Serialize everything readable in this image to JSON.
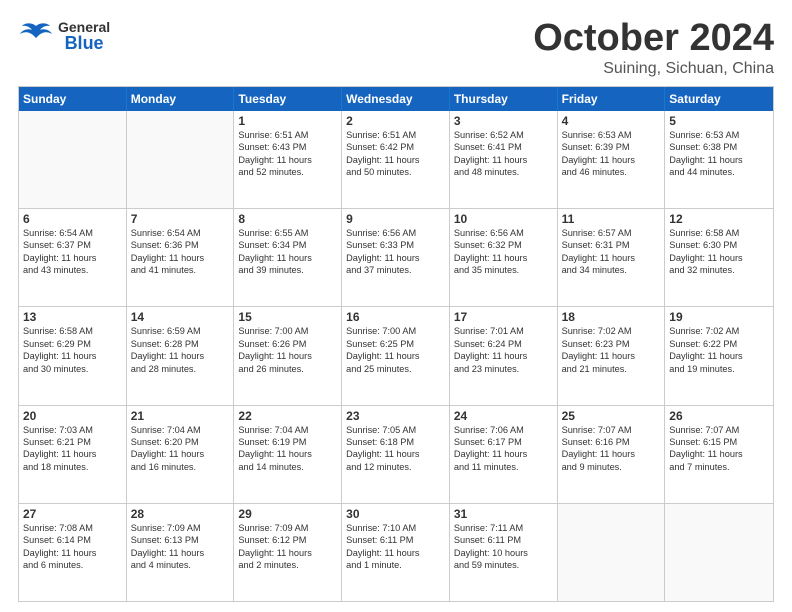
{
  "header": {
    "logo": {
      "general": "General",
      "blue": "Blue"
    },
    "title": "October 2024",
    "subtitle": "Suining, Sichuan, China"
  },
  "calendar": {
    "days": [
      "Sunday",
      "Monday",
      "Tuesday",
      "Wednesday",
      "Thursday",
      "Friday",
      "Saturday"
    ],
    "rows": [
      [
        {
          "day": "",
          "lines": []
        },
        {
          "day": "",
          "lines": []
        },
        {
          "day": "1",
          "lines": [
            "Sunrise: 6:51 AM",
            "Sunset: 6:43 PM",
            "Daylight: 11 hours",
            "and 52 minutes."
          ]
        },
        {
          "day": "2",
          "lines": [
            "Sunrise: 6:51 AM",
            "Sunset: 6:42 PM",
            "Daylight: 11 hours",
            "and 50 minutes."
          ]
        },
        {
          "day": "3",
          "lines": [
            "Sunrise: 6:52 AM",
            "Sunset: 6:41 PM",
            "Daylight: 11 hours",
            "and 48 minutes."
          ]
        },
        {
          "day": "4",
          "lines": [
            "Sunrise: 6:53 AM",
            "Sunset: 6:39 PM",
            "Daylight: 11 hours",
            "and 46 minutes."
          ]
        },
        {
          "day": "5",
          "lines": [
            "Sunrise: 6:53 AM",
            "Sunset: 6:38 PM",
            "Daylight: 11 hours",
            "and 44 minutes."
          ]
        }
      ],
      [
        {
          "day": "6",
          "lines": [
            "Sunrise: 6:54 AM",
            "Sunset: 6:37 PM",
            "Daylight: 11 hours",
            "and 43 minutes."
          ]
        },
        {
          "day": "7",
          "lines": [
            "Sunrise: 6:54 AM",
            "Sunset: 6:36 PM",
            "Daylight: 11 hours",
            "and 41 minutes."
          ]
        },
        {
          "day": "8",
          "lines": [
            "Sunrise: 6:55 AM",
            "Sunset: 6:34 PM",
            "Daylight: 11 hours",
            "and 39 minutes."
          ]
        },
        {
          "day": "9",
          "lines": [
            "Sunrise: 6:56 AM",
            "Sunset: 6:33 PM",
            "Daylight: 11 hours",
            "and 37 minutes."
          ]
        },
        {
          "day": "10",
          "lines": [
            "Sunrise: 6:56 AM",
            "Sunset: 6:32 PM",
            "Daylight: 11 hours",
            "and 35 minutes."
          ]
        },
        {
          "day": "11",
          "lines": [
            "Sunrise: 6:57 AM",
            "Sunset: 6:31 PM",
            "Daylight: 11 hours",
            "and 34 minutes."
          ]
        },
        {
          "day": "12",
          "lines": [
            "Sunrise: 6:58 AM",
            "Sunset: 6:30 PM",
            "Daylight: 11 hours",
            "and 32 minutes."
          ]
        }
      ],
      [
        {
          "day": "13",
          "lines": [
            "Sunrise: 6:58 AM",
            "Sunset: 6:29 PM",
            "Daylight: 11 hours",
            "and 30 minutes."
          ]
        },
        {
          "day": "14",
          "lines": [
            "Sunrise: 6:59 AM",
            "Sunset: 6:28 PM",
            "Daylight: 11 hours",
            "and 28 minutes."
          ]
        },
        {
          "day": "15",
          "lines": [
            "Sunrise: 7:00 AM",
            "Sunset: 6:26 PM",
            "Daylight: 11 hours",
            "and 26 minutes."
          ]
        },
        {
          "day": "16",
          "lines": [
            "Sunrise: 7:00 AM",
            "Sunset: 6:25 PM",
            "Daylight: 11 hours",
            "and 25 minutes."
          ]
        },
        {
          "day": "17",
          "lines": [
            "Sunrise: 7:01 AM",
            "Sunset: 6:24 PM",
            "Daylight: 11 hours",
            "and 23 minutes."
          ]
        },
        {
          "day": "18",
          "lines": [
            "Sunrise: 7:02 AM",
            "Sunset: 6:23 PM",
            "Daylight: 11 hours",
            "and 21 minutes."
          ]
        },
        {
          "day": "19",
          "lines": [
            "Sunrise: 7:02 AM",
            "Sunset: 6:22 PM",
            "Daylight: 11 hours",
            "and 19 minutes."
          ]
        }
      ],
      [
        {
          "day": "20",
          "lines": [
            "Sunrise: 7:03 AM",
            "Sunset: 6:21 PM",
            "Daylight: 11 hours",
            "and 18 minutes."
          ]
        },
        {
          "day": "21",
          "lines": [
            "Sunrise: 7:04 AM",
            "Sunset: 6:20 PM",
            "Daylight: 11 hours",
            "and 16 minutes."
          ]
        },
        {
          "day": "22",
          "lines": [
            "Sunrise: 7:04 AM",
            "Sunset: 6:19 PM",
            "Daylight: 11 hours",
            "and 14 minutes."
          ]
        },
        {
          "day": "23",
          "lines": [
            "Sunrise: 7:05 AM",
            "Sunset: 6:18 PM",
            "Daylight: 11 hours",
            "and 12 minutes."
          ]
        },
        {
          "day": "24",
          "lines": [
            "Sunrise: 7:06 AM",
            "Sunset: 6:17 PM",
            "Daylight: 11 hours",
            "and 11 minutes."
          ]
        },
        {
          "day": "25",
          "lines": [
            "Sunrise: 7:07 AM",
            "Sunset: 6:16 PM",
            "Daylight: 11 hours",
            "and 9 minutes."
          ]
        },
        {
          "day": "26",
          "lines": [
            "Sunrise: 7:07 AM",
            "Sunset: 6:15 PM",
            "Daylight: 11 hours",
            "and 7 minutes."
          ]
        }
      ],
      [
        {
          "day": "27",
          "lines": [
            "Sunrise: 7:08 AM",
            "Sunset: 6:14 PM",
            "Daylight: 11 hours",
            "and 6 minutes."
          ]
        },
        {
          "day": "28",
          "lines": [
            "Sunrise: 7:09 AM",
            "Sunset: 6:13 PM",
            "Daylight: 11 hours",
            "and 4 minutes."
          ]
        },
        {
          "day": "29",
          "lines": [
            "Sunrise: 7:09 AM",
            "Sunset: 6:12 PM",
            "Daylight: 11 hours",
            "and 2 minutes."
          ]
        },
        {
          "day": "30",
          "lines": [
            "Sunrise: 7:10 AM",
            "Sunset: 6:11 PM",
            "Daylight: 11 hours",
            "and 1 minute."
          ]
        },
        {
          "day": "31",
          "lines": [
            "Sunrise: 7:11 AM",
            "Sunset: 6:11 PM",
            "Daylight: 10 hours",
            "and 59 minutes."
          ]
        },
        {
          "day": "",
          "lines": []
        },
        {
          "day": "",
          "lines": []
        }
      ]
    ]
  }
}
